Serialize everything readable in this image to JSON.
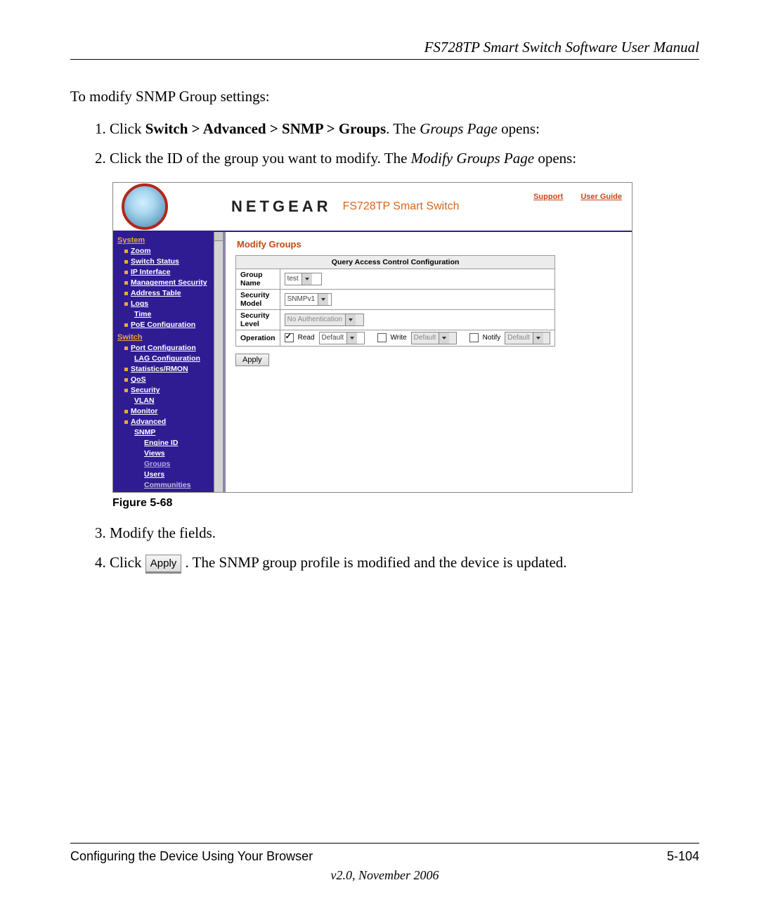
{
  "doc": {
    "title": "FS728TP Smart Switch Software User Manual",
    "intro": "To modify SNMP Group settings:",
    "step1_a": "Click ",
    "step1_bold": "Switch > Advanced > SNMP > Groups",
    "step1_b": ". The ",
    "step1_ital": "Groups Page",
    "step1_c": " opens:",
    "step2_a": "Click the ID of the group you want to modify. The ",
    "step2_ital": "Modify Groups Page",
    "step2_b": " opens:",
    "figure": "Figure 5-68",
    "step3": "Modify the fields.",
    "step4_a": "Click ",
    "step4_btn": "Apply",
    "step4_b": ". The SNMP group profile is modified and the device is updated.",
    "footer_left": "Configuring the Device Using Your Browser",
    "footer_right": "5-104",
    "footer_version": "v2.0, November 2006"
  },
  "shot": {
    "brand": "NETGEAR",
    "product": "FS728TP Smart Switch",
    "links": {
      "support": "Support",
      "guide": "User Guide"
    },
    "sidebar": {
      "system": "System",
      "zoom": "Zoom",
      "switch_status": "Switch Status",
      "ip_interface": "IP Interface",
      "mgmt_security": "Management Security",
      "address_table": "Address Table",
      "logs": "Logs",
      "time": "Time",
      "poe": "PoE Configuration",
      "switch": "Switch",
      "port_config": "Port Configuration",
      "lag_config": "LAG Configuration",
      "stats": "Statistics/RMON",
      "qos": "QoS",
      "security": "Security",
      "vlan": "VLAN",
      "monitor": "Monitor",
      "advanced": "Advanced",
      "snmp": "SNMP",
      "engine": "Engine ID",
      "views": "Views",
      "groups": "Groups",
      "users": "Users",
      "communities": "Communities"
    },
    "panel": {
      "title": "Modify Groups",
      "qacc": "Query Access Control Configuration",
      "group_name_lbl": "Group Name",
      "group_name_val": "test",
      "sec_model_lbl": "Security Model",
      "sec_model_val": "SNMPv1",
      "sec_level_lbl": "Security Level",
      "sec_level_val": "No Authentication",
      "operation_lbl": "Operation",
      "read": "Read",
      "write": "Write",
      "notify": "Notify",
      "default": "Default",
      "apply": "Apply"
    }
  }
}
